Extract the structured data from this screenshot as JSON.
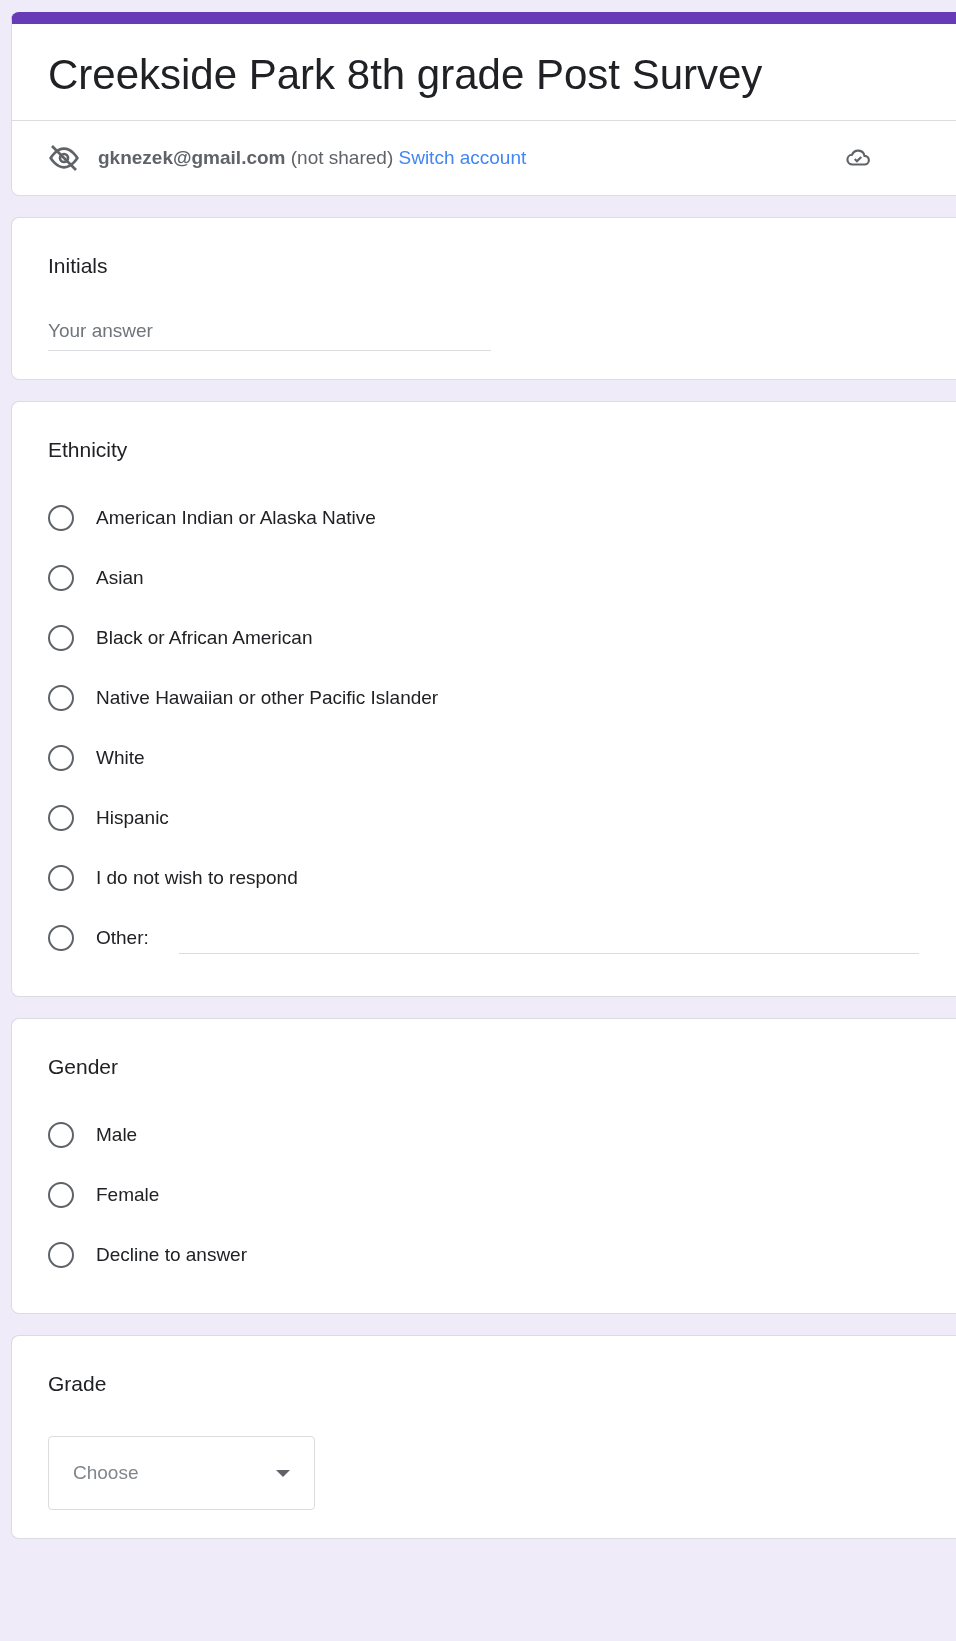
{
  "form": {
    "title": "Creekside Park 8th grade Post Survey",
    "account": {
      "email": "gknezek@gmail.com",
      "note": "(not shared)",
      "switch_link": "Switch account"
    }
  },
  "questions": [
    {
      "kind": "text",
      "title": "Initials",
      "placeholder": "Your answer"
    },
    {
      "kind": "radio",
      "title": "Ethnicity",
      "options": [
        {
          "label": "American Indian or Alaska Native",
          "selected": false
        },
        {
          "label": "Asian",
          "selected": false
        },
        {
          "label": "Black or African American",
          "selected": false
        },
        {
          "label": "Native Hawaiian or other Pacific Islander",
          "selected": false
        },
        {
          "label": "White",
          "selected": false
        },
        {
          "label": "Hispanic",
          "selected": false
        },
        {
          "label": "I do not wish to respond",
          "selected": false
        },
        {
          "label": "Other:",
          "selected": false,
          "kind": "other"
        }
      ]
    },
    {
      "kind": "radio",
      "title": "Gender",
      "options": [
        {
          "label": "Male",
          "selected": false
        },
        {
          "label": "Female",
          "selected": false
        },
        {
          "label": "Decline to answer",
          "selected": false
        }
      ]
    },
    {
      "kind": "dropdown",
      "title": "Grade",
      "placeholder": "Choose"
    }
  ]
}
